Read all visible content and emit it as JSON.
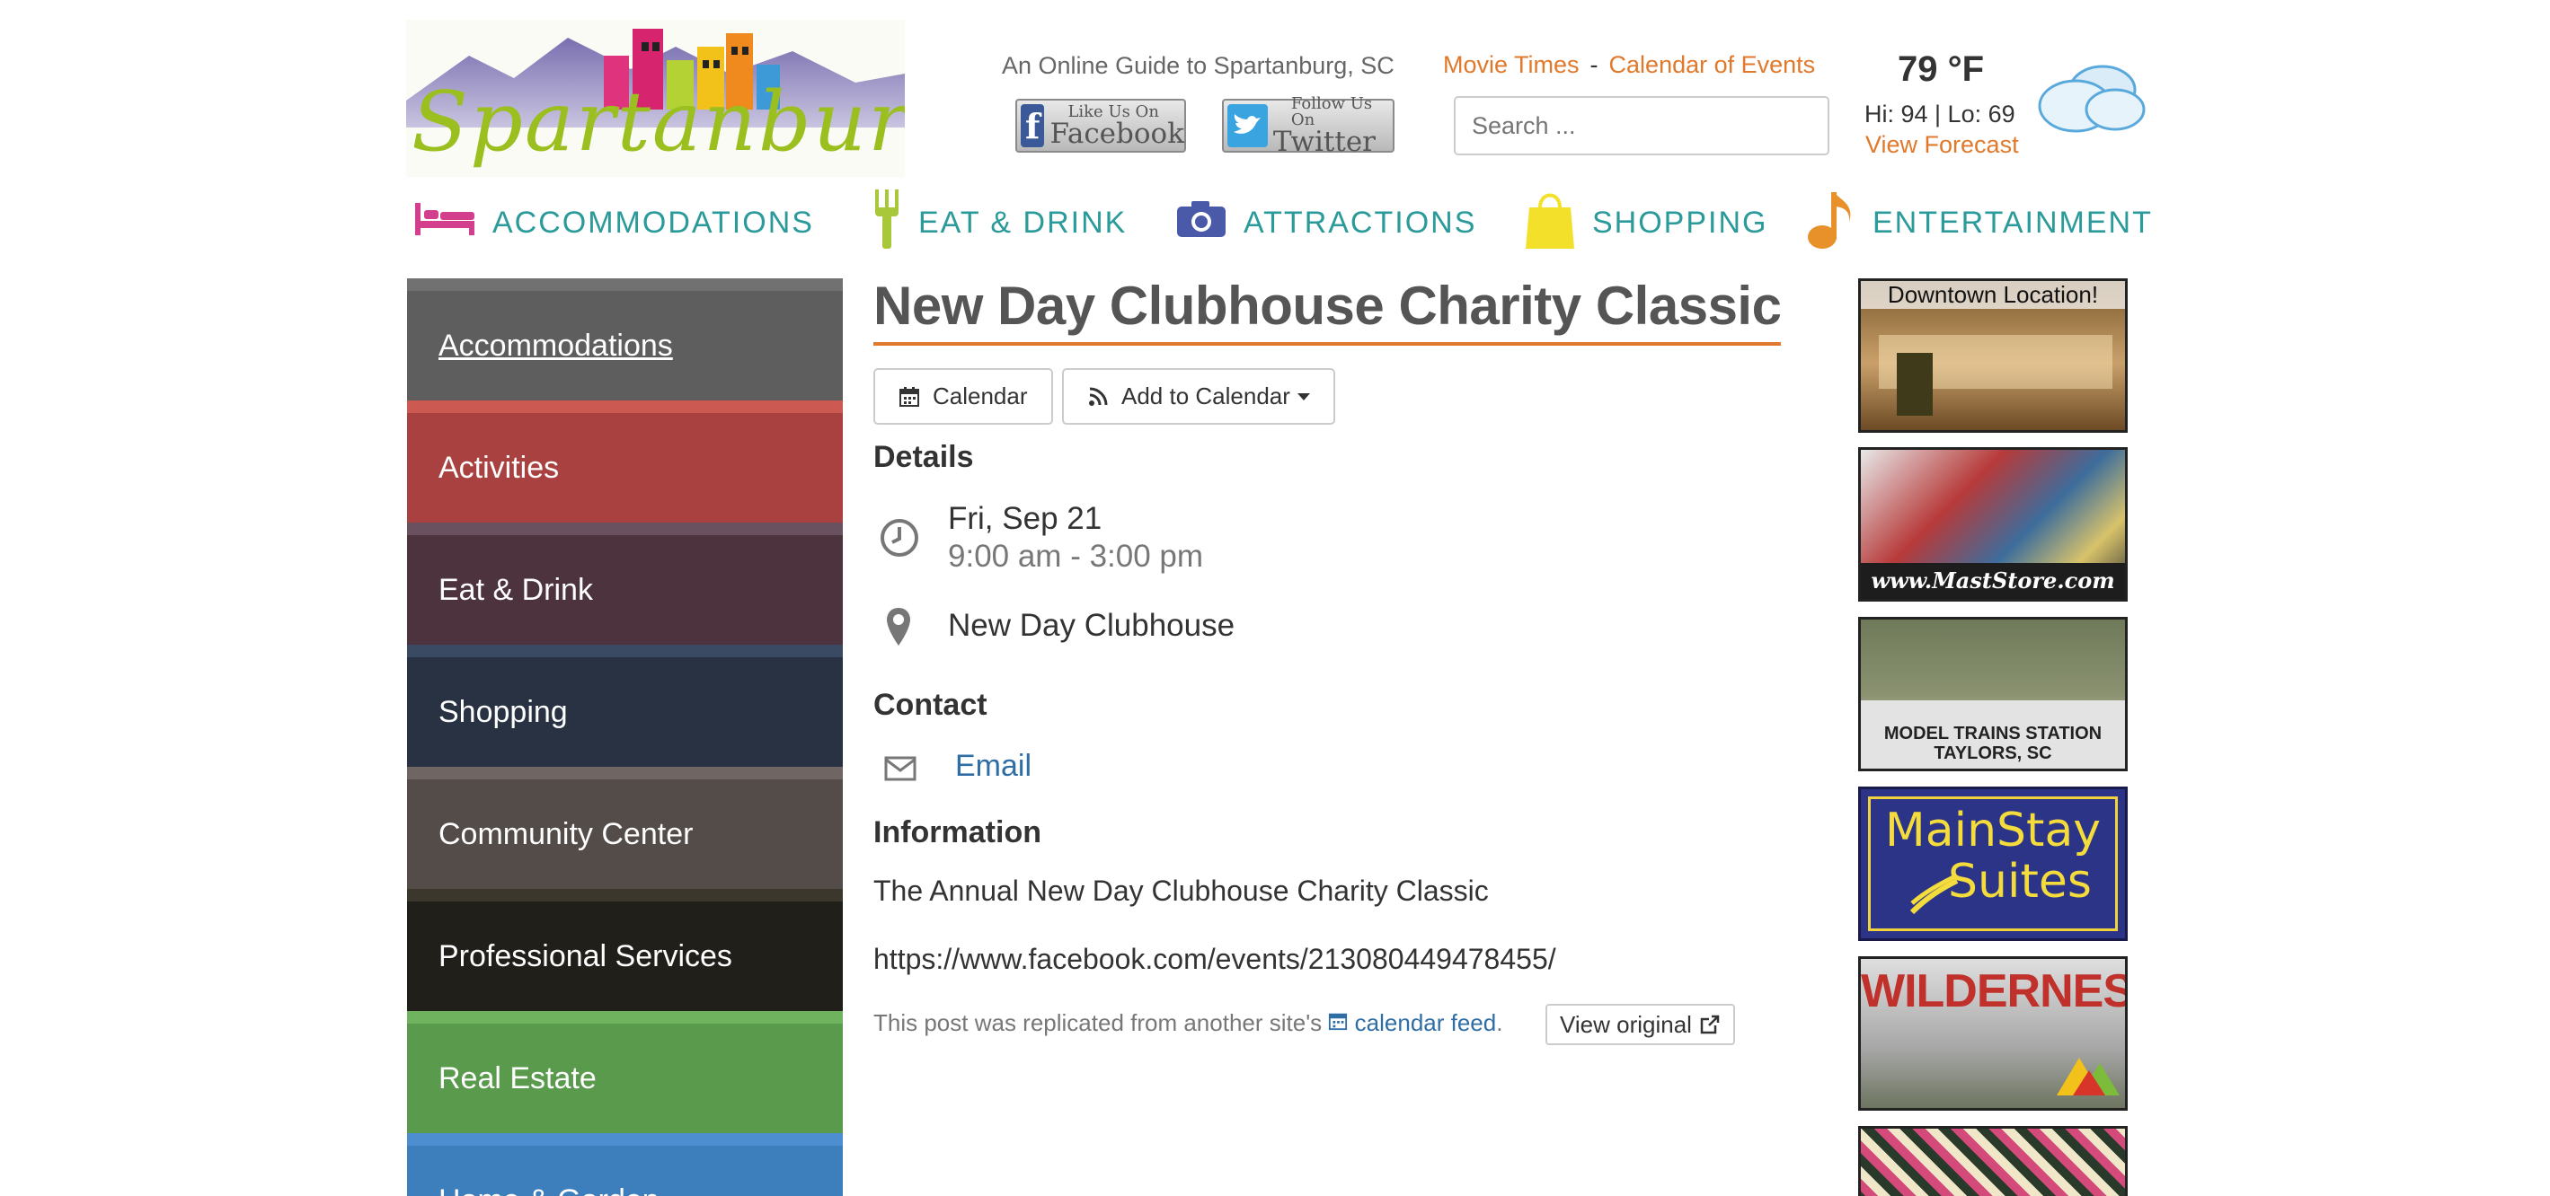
{
  "header": {
    "logo_text": "Spartanburg",
    "tagline": "An Online Guide to Spartanburg, SC",
    "facebook": {
      "small": "Like Us On",
      "big": "Facebook",
      "icon": "facebook-icon"
    },
    "twitter": {
      "small": "Follow Us On",
      "big": "Twitter",
      "icon": "twitter-icon"
    },
    "links": [
      {
        "label": "Movie Times"
      },
      {
        "label": "Calendar of Events"
      }
    ],
    "link_separator": "-",
    "search_placeholder": "Search ...",
    "weather": {
      "temp": "79 °F",
      "hilo": "Hi: 94 | Lo: 69",
      "forecast_link": "View Forecast",
      "icon": "cloud-icon"
    }
  },
  "main_nav": [
    {
      "label": "ACCOMMODATIONS",
      "icon": "bed-icon",
      "color": "#d33f8d"
    },
    {
      "label": "EAT & DRINK",
      "icon": "fork-icon",
      "color": "#a8c83a"
    },
    {
      "label": "ATTRACTIONS",
      "icon": "camera-icon",
      "color": "#4b5aa8"
    },
    {
      "label": "SHOPPING",
      "icon": "shopping-bag-icon",
      "color": "#f2e02a"
    },
    {
      "label": "ENTERTAINMENT",
      "icon": "music-note-icon",
      "color": "#e8902a"
    }
  ],
  "sidebar": {
    "items": [
      {
        "label": "Accommodations",
        "bg": "#5e5e5e",
        "accent": "#717171",
        "active": true
      },
      {
        "label": "Activities",
        "bg": "#a94140",
        "accent": "#cc5a52"
      },
      {
        "label": "Eat & Drink",
        "bg": "#4d333e",
        "accent": "#6a5160"
      },
      {
        "label": "Shopping",
        "bg": "#283243",
        "accent": "#3a4a63"
      },
      {
        "label": "Community Center",
        "bg": "#534c49",
        "accent": "#6f6562"
      },
      {
        "label": "Professional Services",
        "bg": "#211f19",
        "accent": "#3b372d"
      },
      {
        "label": "Real Estate",
        "bg": "#5a9a4d",
        "accent": "#70b35f"
      },
      {
        "label": "Home & Garden",
        "bg": "#3d7ebc",
        "accent": "#4c8ed0"
      }
    ]
  },
  "event": {
    "title": "New Day Clubhouse Charity Classic",
    "buttons": {
      "calendar": "Calendar",
      "add_to_calendar": "Add to Calendar"
    },
    "details_heading": "Details",
    "date": "Fri, Sep 21",
    "time": "9:00 am - 3:00 pm",
    "location": "New Day Clubhouse",
    "contact_heading": "Contact",
    "email_label": "Email",
    "information_heading": "Information",
    "information_text": "The Annual New Day Clubhouse Charity Classic",
    "information_url": "https://www.facebook.com/events/213080449478455/",
    "replicated_prefix": "This post was replicated from another site's",
    "replicated_link": "calendar feed",
    "replicated_suffix": ".",
    "view_original": "View original"
  },
  "ads": [
    {
      "caption": "Downtown Location!"
    },
    {
      "caption": "www.MastStore.com"
    },
    {
      "caption_line1": "MODEL TRAINS STATION",
      "caption_line2": "TAYLORS, SC"
    },
    {
      "caption_line1": "MainStay",
      "caption_line2": "Suites"
    },
    {
      "caption": "WILDERNESS"
    },
    {
      "caption": ""
    }
  ]
}
